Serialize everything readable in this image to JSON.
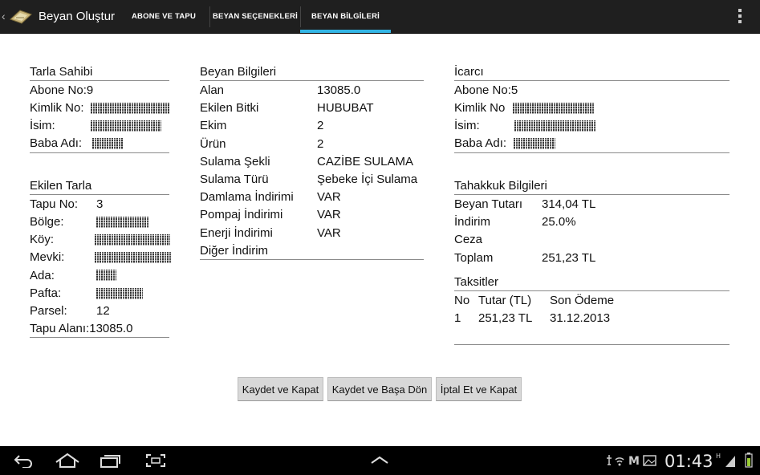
{
  "app": {
    "title": "Beyan Oluştur"
  },
  "tabs": [
    {
      "label": "ABONE VE TAPU",
      "selected": false
    },
    {
      "label": "BEYAN SEÇENEKLERİ",
      "selected": false
    },
    {
      "label": "BEYAN BİLGİLERİ",
      "selected": true
    }
  ],
  "tarla_sahibi": {
    "title": "Tarla Sahibi",
    "abone_no": "Abone No:9",
    "kimlik_label": "Kimlik No:",
    "isim_label": "İsim:",
    "baba_label": "Baba Adı:"
  },
  "ekilen_tarla": {
    "title": "Ekilen Tarla",
    "tapu_no_label": "Tapu No:",
    "tapu_no": "3",
    "bolge_label": "Bölge:",
    "koy_label": "Köy:",
    "mevki_label": "Mevki:",
    "ada_label": "Ada:",
    "pafta_label": "Pafta:",
    "parsel_label": "Parsel:",
    "parsel": "12",
    "tapu_alani": "Tapu Alanı:13085.0"
  },
  "beyan_bilgileri": {
    "title": "Beyan Bilgileri",
    "rows": [
      {
        "label": "Alan",
        "value": "13085.0"
      },
      {
        "label": "Ekilen Bitki",
        "value": "HUBUBAT"
      },
      {
        "label": "Ekim",
        "value": "2"
      },
      {
        "label": "Ürün",
        "value": "2"
      },
      {
        "label": "Sulama Şekli",
        "value": "CAZİBE SULAMA"
      },
      {
        "label": "Sulama Türü",
        "value": "Şebeke İçi Sulama"
      },
      {
        "label": "Damlama İndirimi",
        "value": "VAR"
      },
      {
        "label": "Pompaj İndirimi",
        "value": "VAR"
      },
      {
        "label": "Enerji İndirimi",
        "value": "VAR"
      },
      {
        "label": "Diğer İndirim",
        "value": ""
      }
    ]
  },
  "icarci": {
    "title": "İcarcı",
    "abone_no": "Abone No:5",
    "kimlik_label": "Kimlik No",
    "isim_label": "İsim:",
    "baba_label": "Baba Adı:"
  },
  "tahakkuk": {
    "title": "Tahakkuk Bilgileri",
    "rows": [
      {
        "label": "Beyan Tutarı",
        "value": "314,04 TL"
      },
      {
        "label": "İndirim",
        "value": "25.0%"
      },
      {
        "label": "Ceza",
        "value": ""
      },
      {
        "label": "Toplam",
        "value": "251,23 TL"
      }
    ]
  },
  "taksitler": {
    "title": "Taksitler",
    "headers": [
      "No",
      "Tutar (TL)",
      "Son Ödeme"
    ],
    "rows": [
      [
        "1",
        "251,23 TL",
        "31.12.2013"
      ]
    ]
  },
  "buttons": {
    "save_close": "Kaydet ve Kapat",
    "save_start": "Kaydet ve Başa Dön",
    "cancel_close": "İptal Et ve Kapat"
  },
  "status": {
    "time": "01:43"
  },
  "colors": {
    "actionbar": "#1f1f1f",
    "tab_indicator": "#33b5e5",
    "navbar": "#000000"
  }
}
